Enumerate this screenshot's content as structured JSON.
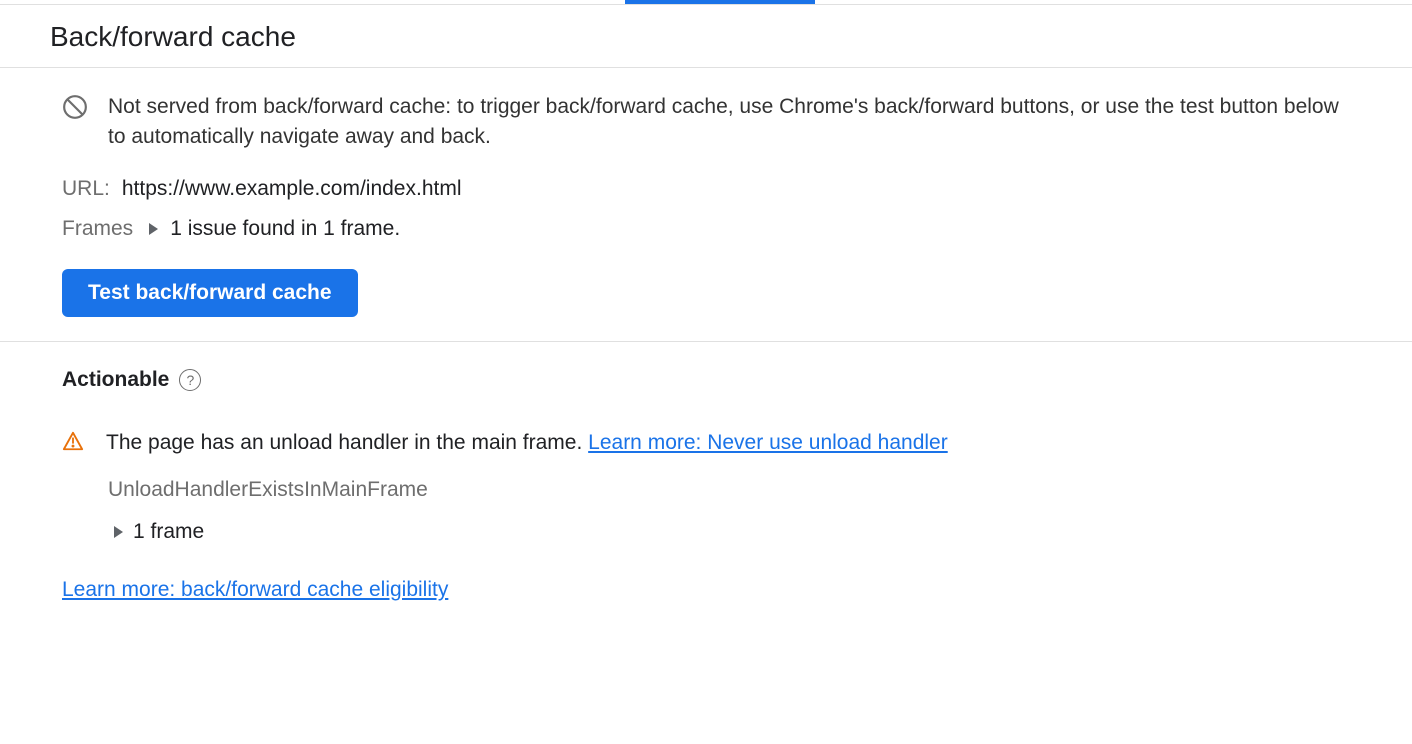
{
  "header": {
    "title": "Back/forward cache"
  },
  "top": {
    "info_text": "Not served from back/forward cache: to trigger back/forward cache, use Chrome's back/forward buttons, or use the test button below to automatically navigate away and back.",
    "url_label": "URL:",
    "url_value": "https://www.example.com/index.html",
    "frames_label": "Frames",
    "frames_summary": "1 issue found in 1 frame.",
    "test_button": "Test back/forward cache"
  },
  "actionable": {
    "heading": "Actionable",
    "issue_text": "The page has an unload handler in the main frame. ",
    "issue_link": "Learn more: Never use unload handler",
    "issue_code": "UnloadHandlerExistsInMainFrame",
    "frame_count": "1 frame",
    "bottom_link": "Learn more: back/forward cache eligibility"
  }
}
